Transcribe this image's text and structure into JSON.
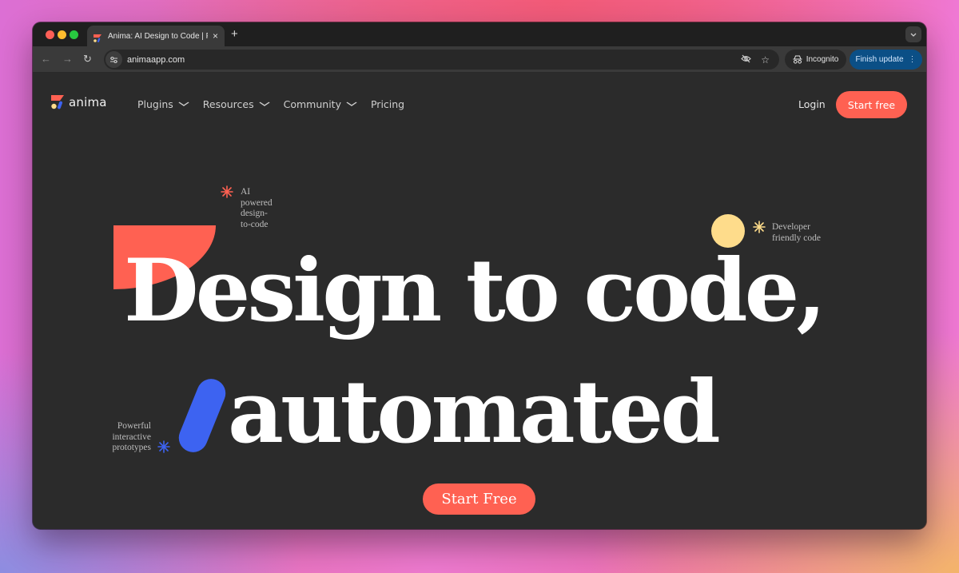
{
  "browser": {
    "tab": {
      "title": "Anima: AI Design to Code | Fig",
      "favicon": "anima-logo-icon",
      "close_icon": "×"
    },
    "new_tab_icon": "+",
    "tab_menu_icon": "⌄",
    "nav": {
      "back_icon": "←",
      "forward_icon": "→",
      "reload_icon": "↻"
    },
    "omnibox": {
      "site_info_icon": "⚙",
      "url": "animaapp.com",
      "eye_off_icon": "◎",
      "star_icon": "☆"
    },
    "incognito": {
      "icon": "⛟",
      "label": "Incognito"
    },
    "finish_update": {
      "label": "Finish update",
      "menu_icon": "⋮"
    }
  },
  "site": {
    "logo_text": "anima",
    "nav_links": [
      {
        "label": "Plugins",
        "has_dropdown": true
      },
      {
        "label": "Resources",
        "has_dropdown": true
      },
      {
        "label": "Community",
        "has_dropdown": true
      },
      {
        "label": "Pricing",
        "has_dropdown": false
      }
    ],
    "chevron_icon": "∨",
    "login_label": "Login",
    "start_free_label": "Start free",
    "colors": {
      "accent_coral": "#ff6152",
      "accent_yellow": "#fedc8b",
      "accent_blue": "#3d63f1",
      "background": "#2b2b2b"
    }
  },
  "hero": {
    "headline_line1": "Design to code,",
    "headline_line2": "automated",
    "annotations": [
      {
        "text": "AI powered design-to-code",
        "lines": [
          "AI",
          "powered",
          "design-",
          "to-code"
        ],
        "spark_icon": "✳"
      },
      {
        "text": "Developer friendly code",
        "lines": [
          "Developer",
          "friendly code"
        ],
        "spark_icon": "✳"
      },
      {
        "text": "Powerful interactive prototypes",
        "lines": [
          "Powerful",
          "interactive",
          "prototypes"
        ],
        "spark_icon": "✳"
      }
    ],
    "cta_label": "Start Free"
  }
}
